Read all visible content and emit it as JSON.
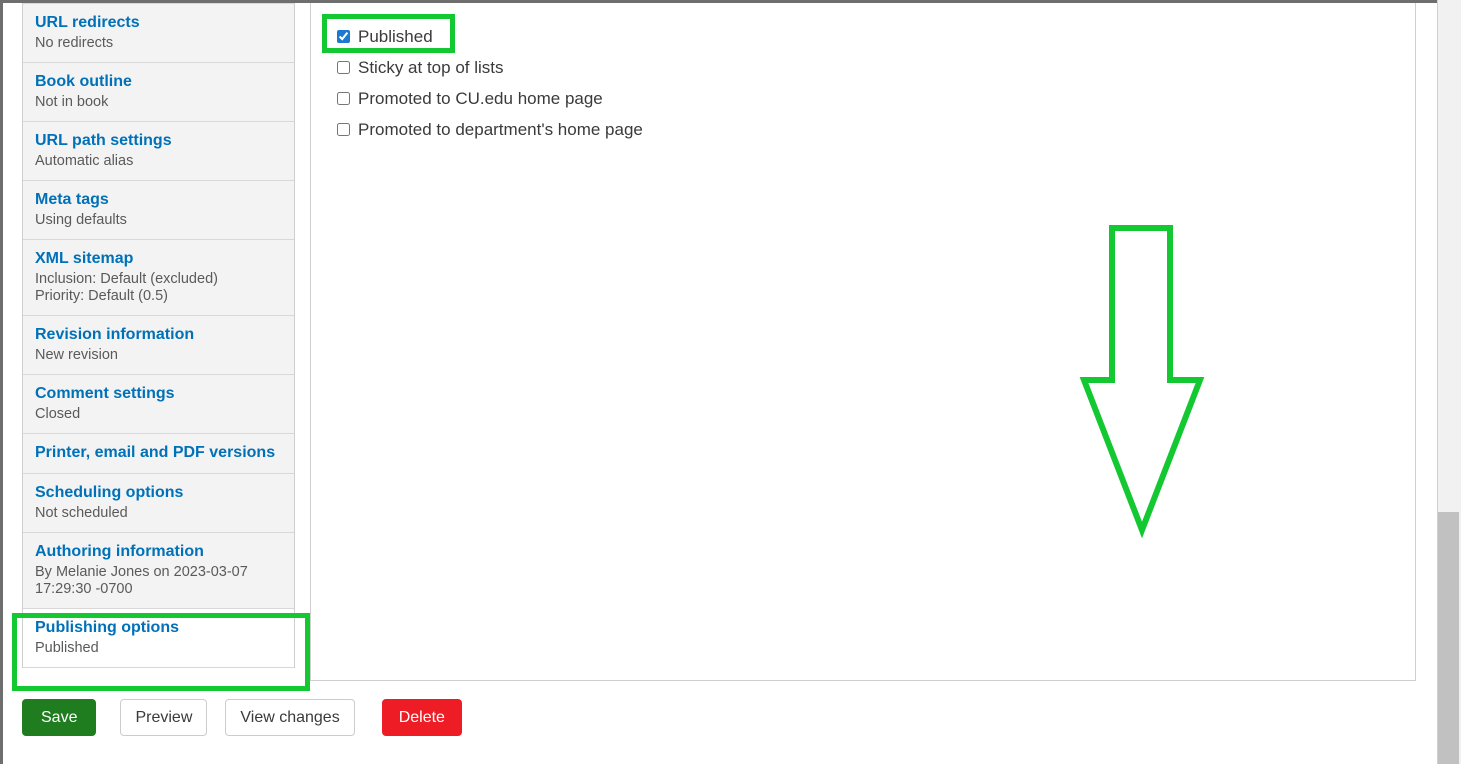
{
  "sidebar": {
    "items": [
      {
        "title": "URL redirects",
        "summary": [
          "No redirects"
        ],
        "active": false
      },
      {
        "title": "Book outline",
        "summary": [
          "Not in book"
        ],
        "active": false
      },
      {
        "title": "URL path settings",
        "summary": [
          "Automatic alias"
        ],
        "active": false
      },
      {
        "title": "Meta tags",
        "summary": [
          "Using defaults"
        ],
        "active": false
      },
      {
        "title": "XML sitemap",
        "summary": [
          "Inclusion: Default (excluded)",
          "Priority: Default (0.5)"
        ],
        "active": false
      },
      {
        "title": "Revision information",
        "summary": [
          "New revision"
        ],
        "active": false
      },
      {
        "title": "Comment settings",
        "summary": [
          "Closed"
        ],
        "active": false
      },
      {
        "title": "Printer, email and PDF versions",
        "summary": [],
        "active": false
      },
      {
        "title": "Scheduling options",
        "summary": [
          "Not scheduled"
        ],
        "active": false
      },
      {
        "title": "Authoring information",
        "summary": [
          "By Melanie Jones on 2023-03-07",
          "17:29:30 -0700"
        ],
        "active": false
      },
      {
        "title": "Publishing options",
        "summary": [
          "Published"
        ],
        "active": true
      }
    ]
  },
  "main": {
    "checkboxes": [
      {
        "label": "Published",
        "checked": true
      },
      {
        "label": "Sticky at top of lists",
        "checked": false
      },
      {
        "label": "Promoted to CU.edu home page",
        "checked": false
      },
      {
        "label": "Promoted to department's home page",
        "checked": false
      }
    ]
  },
  "actions": {
    "save_label": "Save",
    "preview_label": "Preview",
    "view_changes_label": "View changes",
    "delete_label": "Delete"
  },
  "annotations": {
    "highlight_color": "#14c832",
    "arrow": {
      "icon": "down-arrow-annotation",
      "direction": "down"
    },
    "boxes": [
      {
        "icon": "highlight-box",
        "target": "published-checkbox"
      },
      {
        "icon": "highlight-box",
        "target": "publishing-options-tab"
      }
    ]
  },
  "colors": {
    "link": "#0071b8",
    "save_button": "#1f7d1f",
    "delete_button": "#ee1c25",
    "checkbox_accent": "#1b79d0",
    "annotation_green": "#14c832"
  }
}
